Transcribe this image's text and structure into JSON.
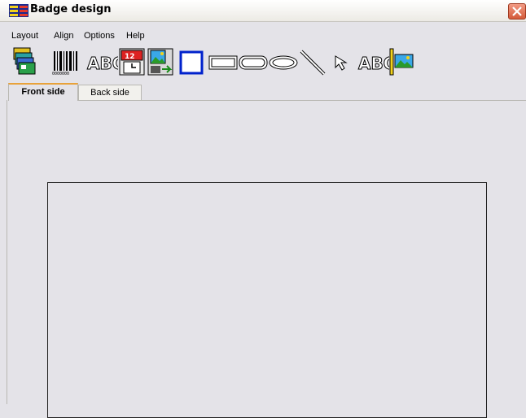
{
  "window": {
    "title": "Badge design",
    "app_icon": "badge-app-icon",
    "close_icon": "close-icon"
  },
  "menu": {
    "items": [
      "Layout",
      "Align",
      "Options",
      "Help"
    ]
  },
  "toolbar": {
    "tools": [
      "cards-stack-icon",
      "barcode-icon",
      "text-abc-icon",
      "date-time-icon",
      "picture-import-icon",
      "square-icon",
      "rectangle-icon",
      "rounded-rectangle-icon",
      "ellipse-icon",
      "line-icon",
      "pointer-icon",
      "text-outline-abc-icon",
      "image-icon"
    ],
    "text_glyph": "ABC"
  },
  "tabs": {
    "front": "Front side",
    "back": "Back side"
  },
  "colors": {
    "workspace": "#e4e3e8",
    "close": "#d45a3a",
    "active_tab_accent": "#e8a23a"
  }
}
